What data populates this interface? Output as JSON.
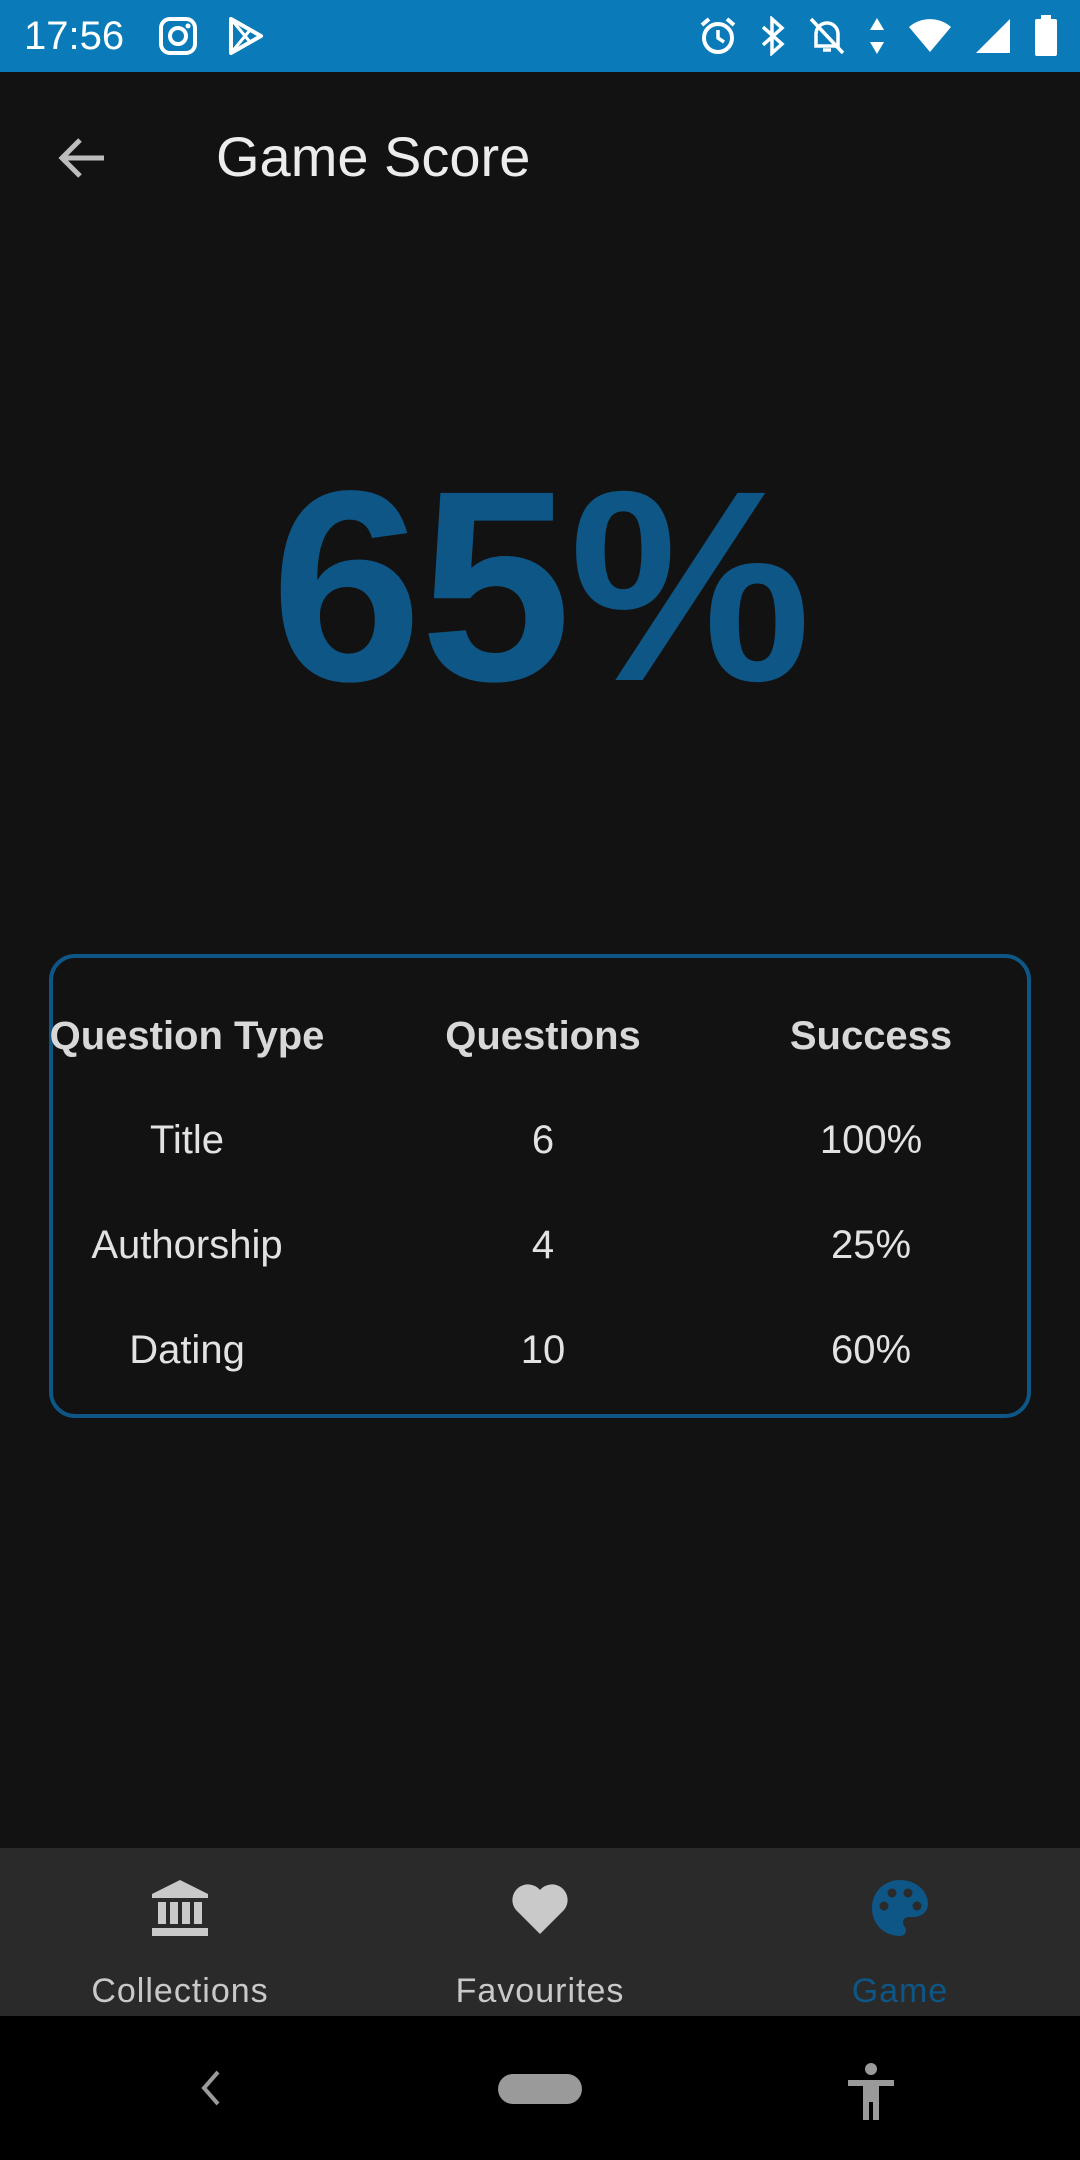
{
  "status_bar": {
    "time": "17:56",
    "left_icons": [
      "instagram-icon",
      "play-store-icon"
    ],
    "right_icons": [
      "alarm-icon",
      "bluetooth-icon",
      "notifications-off-icon",
      "data-arrows-icon",
      "wifi-icon",
      "signal-icon",
      "battery-icon"
    ],
    "background": "#0a7bb8"
  },
  "app_bar": {
    "title": "Game Score",
    "back_icon": "arrow-back-icon"
  },
  "score": {
    "value": "65%",
    "color": "#0d5686"
  },
  "stats_table": {
    "headers": [
      "Question Type",
      "Questions",
      "Success"
    ],
    "rows": [
      {
        "type": "Title",
        "questions": "6",
        "success": "100%"
      },
      {
        "type": "Authorship",
        "questions": "4",
        "success": "25%"
      },
      {
        "type": "Dating",
        "questions": "10",
        "success": "60%"
      }
    ],
    "border_color": "#0d5686"
  },
  "bottom_nav": {
    "items": [
      {
        "label": "Collections",
        "icon": "museum-icon",
        "active": false
      },
      {
        "label": "Favourites",
        "icon": "heart-icon",
        "active": false
      },
      {
        "label": "Game",
        "icon": "palette-icon",
        "active": true
      }
    ],
    "active_color": "#0d5686"
  },
  "system_nav": {
    "icons": [
      "back-icon",
      "home-pill",
      "accessibility-icon"
    ]
  }
}
